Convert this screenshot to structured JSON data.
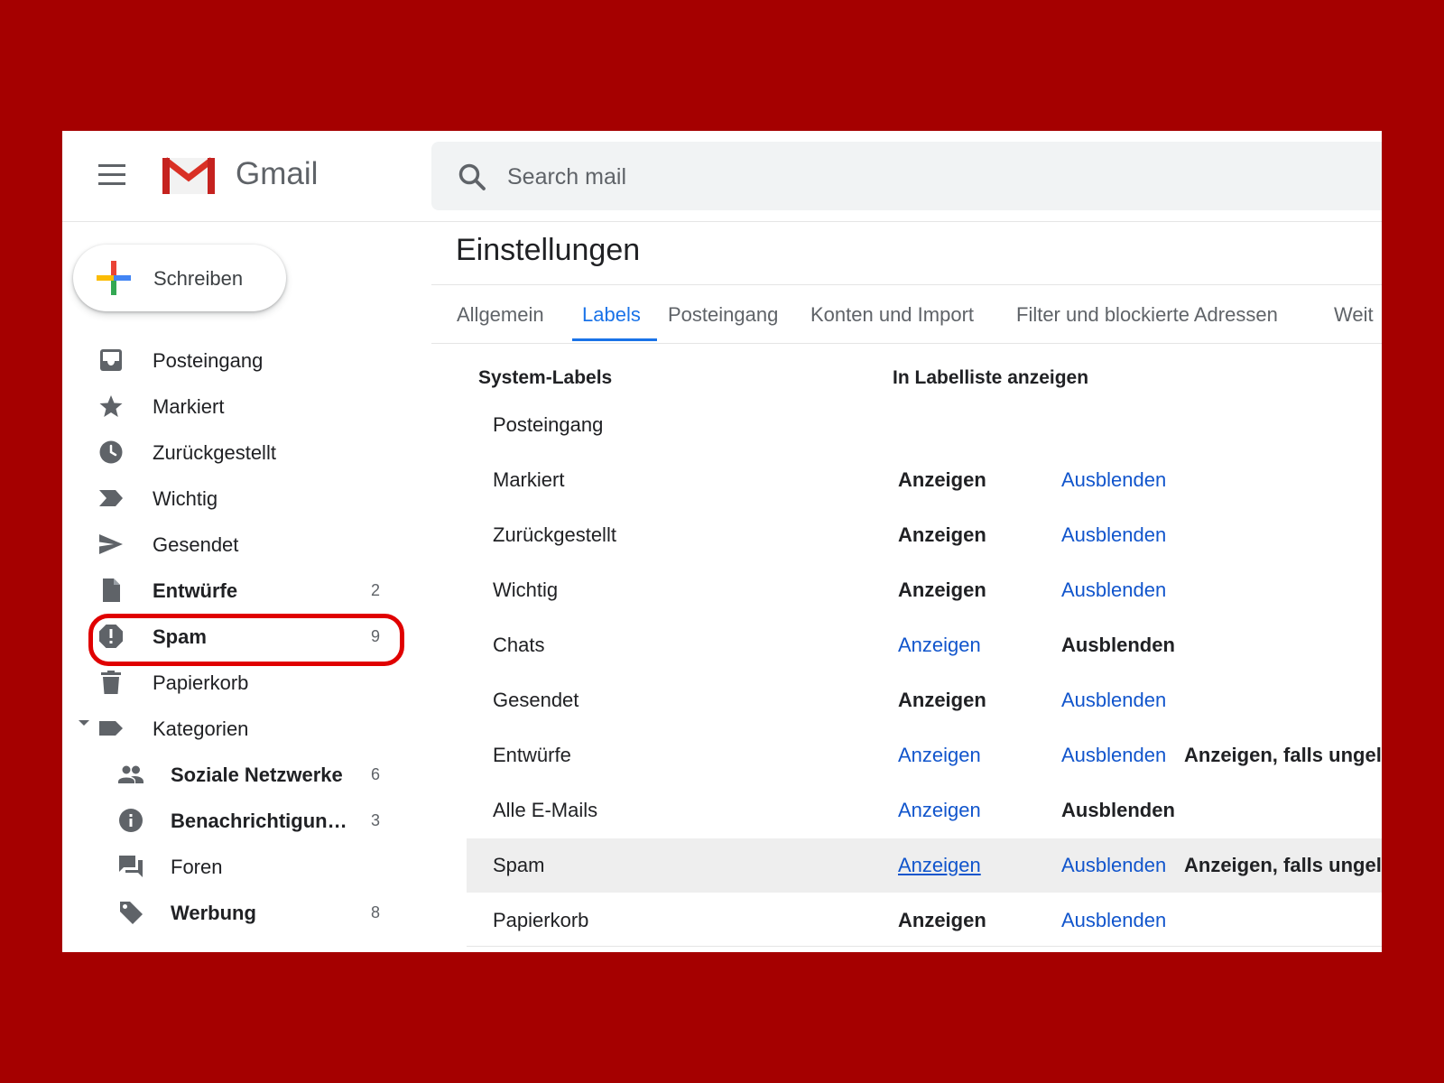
{
  "header": {
    "brand": "Gmail",
    "search_placeholder": "Search mail"
  },
  "compose": {
    "label": "Schreiben"
  },
  "sidebar": {
    "items": [
      {
        "label": "Posteingang",
        "count": "",
        "icon": "inbox-icon"
      },
      {
        "label": "Markiert",
        "count": "",
        "icon": "star-icon"
      },
      {
        "label": "Zurückgestellt",
        "count": "",
        "icon": "clock-icon"
      },
      {
        "label": "Wichtig",
        "count": "",
        "icon": "important-icon"
      },
      {
        "label": "Gesendet",
        "count": "",
        "icon": "send-icon"
      },
      {
        "label": "Entwürfe",
        "count": "2",
        "icon": "draft-icon"
      },
      {
        "label": "Spam",
        "count": "9",
        "icon": "spam-icon"
      },
      {
        "label": "Papierkorb",
        "count": "",
        "icon": "trash-icon"
      },
      {
        "label": "Kategorien",
        "count": "",
        "icon": "label-icon"
      },
      {
        "label": "Soziale Netzwerke",
        "count": "6",
        "icon": "people-icon"
      },
      {
        "label": "Benachrichtigungen",
        "count": "3",
        "icon": "info-icon"
      },
      {
        "label": "Foren",
        "count": "",
        "icon": "forum-icon"
      },
      {
        "label": "Werbung",
        "count": "8",
        "icon": "tag-icon"
      }
    ]
  },
  "settings": {
    "title": "Einstellungen",
    "tabs": [
      "Allgemein",
      "Labels",
      "Posteingang",
      "Konten und Import",
      "Filter und blockierte Adressen",
      "Weit"
    ],
    "active_tab": "Labels",
    "col_system": "System-Labels",
    "col_show": "In Labelliste anzeigen",
    "action_show": "Anzeigen",
    "action_hide": "Ausblenden",
    "action_unread": "Anzeigen, falls ungelesen",
    "rows": [
      {
        "name": "Posteingang"
      },
      {
        "name": "Markiert"
      },
      {
        "name": "Zurückgestellt"
      },
      {
        "name": "Wichtig"
      },
      {
        "name": "Chats"
      },
      {
        "name": "Gesendet"
      },
      {
        "name": "Entwürfe"
      },
      {
        "name": "Alle E-Mails"
      },
      {
        "name": "Spam"
      },
      {
        "name": "Papierkorb"
      }
    ]
  },
  "colors": {
    "background": "#a50000",
    "accent": "#1a73e8",
    "link": "#1155cc",
    "highlight_ring": "#e00000"
  }
}
